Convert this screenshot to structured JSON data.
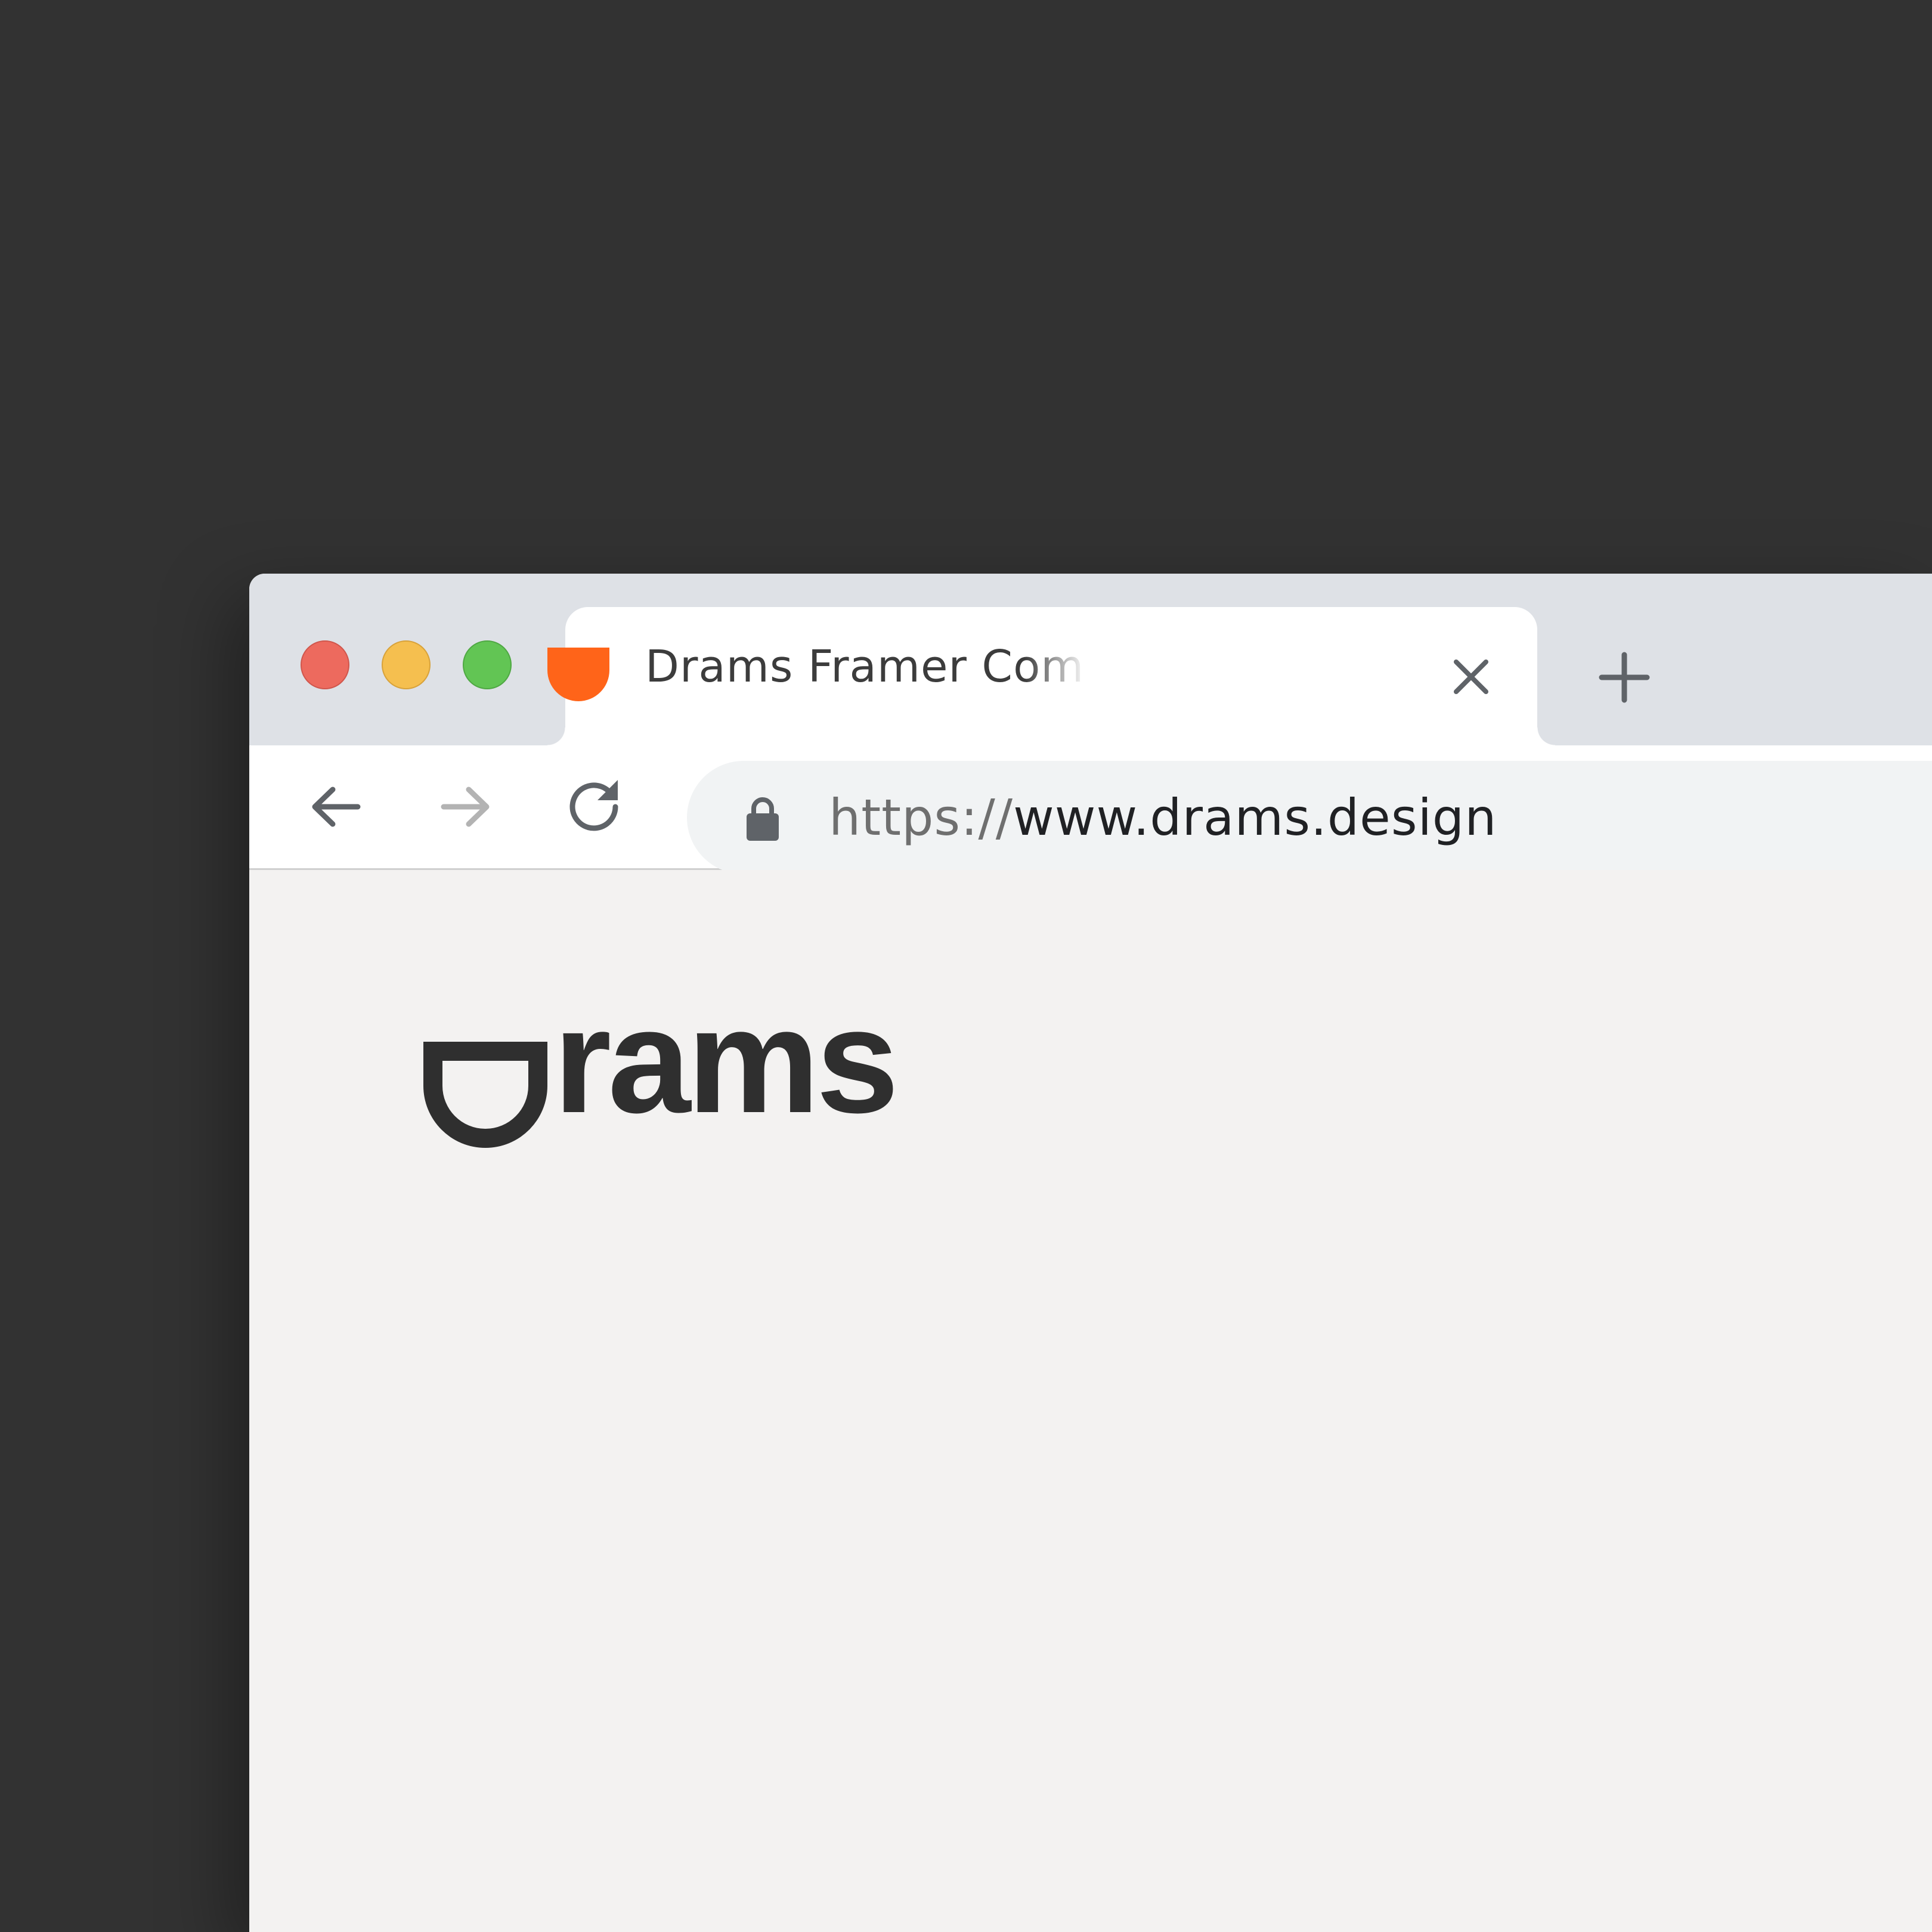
{
  "browser": {
    "tab": {
      "title": "Drams Framer Component Design",
      "favicon_color": "#ff6419"
    },
    "address_bar": {
      "scheme": "https://",
      "host": "www.drams.design"
    },
    "icons": {
      "back": "arrow-left-icon",
      "forward": "arrow-right-icon",
      "reload": "reload-icon",
      "lock": "lock-icon",
      "close_tab": "close-icon",
      "new_tab": "plus-icon"
    },
    "window_controls": {
      "close_color": "#ed6a5e",
      "minimize_color": "#f5bf4f",
      "maximize_color": "#62c554"
    }
  },
  "page": {
    "logo_text": "rams",
    "logo_color": "#2f2f2f",
    "background": "#f3f2f1"
  }
}
